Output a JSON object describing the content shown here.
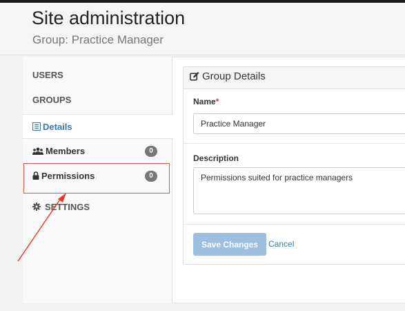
{
  "header": {
    "title": "Site administration",
    "subtitle": "Group: Practice Manager"
  },
  "sidebar": {
    "users_label": "USERS",
    "groups_label": "GROUPS",
    "items": [
      {
        "label": "Details",
        "icon": "list-icon",
        "active": true
      },
      {
        "label": "Members",
        "icon": "users-icon",
        "badge": "0"
      },
      {
        "label": "Permissions",
        "icon": "lock-icon",
        "badge": "0"
      }
    ],
    "settings_label": "SETTINGS"
  },
  "panel": {
    "title": "Group Details",
    "name_label": "Name",
    "required_mark": "*",
    "name_value": "Practice Manager",
    "description_label": "Description",
    "description_value": "Permissions suited for practice managers",
    "save_label": "Save Changes",
    "cancel_label": "Cancel"
  },
  "colors": {
    "accent": "#337ab7",
    "save_button": "#9cbfe0",
    "badge": "#777777",
    "highlight": "#d9534f",
    "arrow": "#e8392b"
  }
}
